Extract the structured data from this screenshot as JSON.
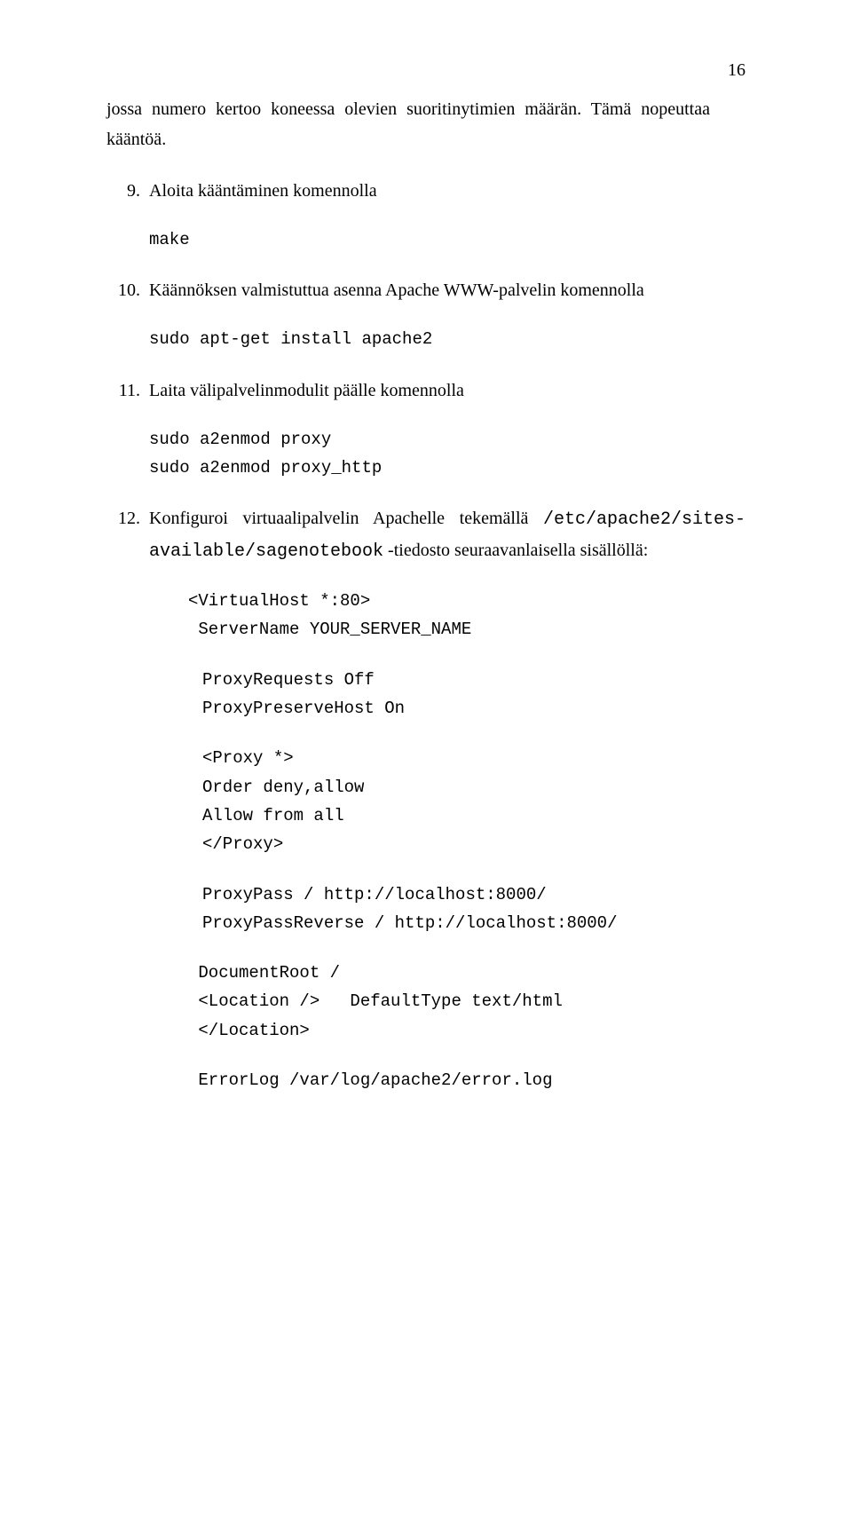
{
  "page_number": "16",
  "para1": "jossa numero kertoo koneessa olevien suoritinytimien määrän. Tämä nopeuttaa kääntöä.",
  "item9_num": "9.",
  "item9_text": "Aloita kääntäminen komennolla",
  "code9": "make",
  "item10_num": "10.",
  "item10_text": "Käännöksen valmistuttua asenna Apache WWW-palvelin komennolla",
  "code10": "sudo apt-get install apache2",
  "item11_num": "11.",
  "item11_text": "Laita välipalvelinmodulit päälle komennolla",
  "code11": "sudo a2enmod proxy\nsudo a2enmod proxy_http",
  "item12_num": "12.",
  "item12_pre": "Konfiguroi virtuaalipalvelin Apachelle tekemällä ",
  "item12_code": "/etc/apache2/sites-available/sagenotebook",
  "item12_post": " -tiedosto seuraavanlaisella sisällöllä:",
  "vh_open": "<VirtualHost *:80>",
  "vh_server": " ServerName YOUR_SERVER_NAME",
  "vh_block2": "ProxyRequests Off\nProxyPreserveHost On",
  "vh_block3": "<Proxy *>\nOrder deny,allow\nAllow from all\n</Proxy>",
  "vh_block4": "ProxyPass / http://localhost:8000/\nProxyPassReverse / http://localhost:8000/",
  "vh_block5": " DocumentRoot /\n <Location />   DefaultType text/html\n </Location>",
  "vh_block6": " ErrorLog /var/log/apache2/error.log"
}
